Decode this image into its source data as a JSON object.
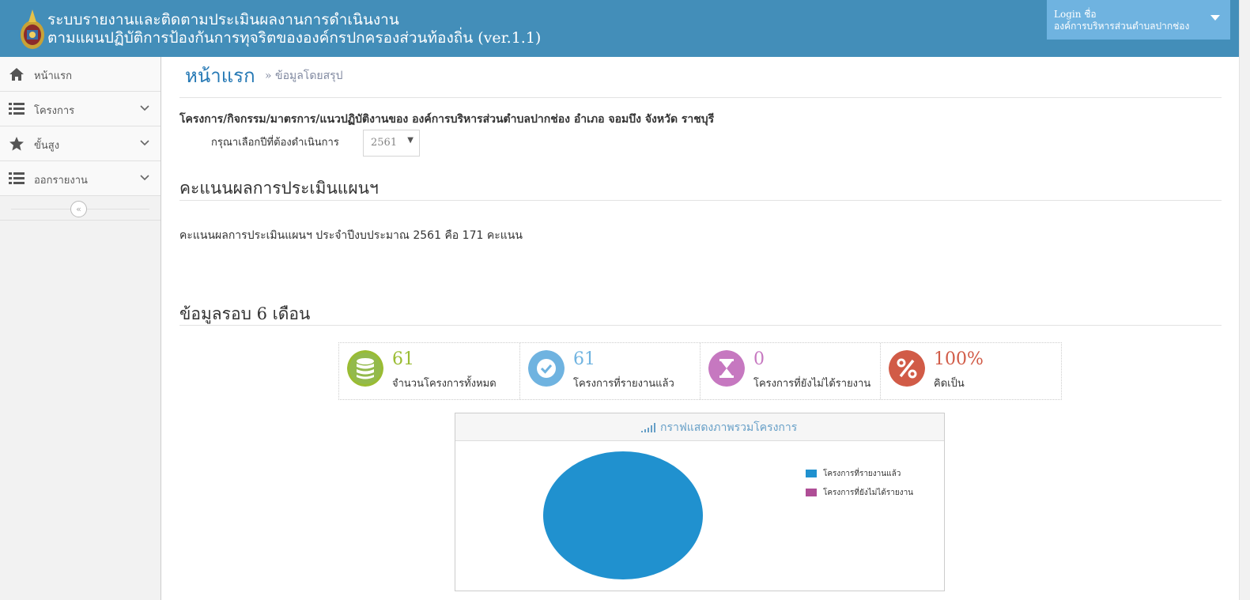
{
  "header": {
    "title_line1": "ระบบรายงานและติดตามประเมินผลงานการดำเนินงาน",
    "title_line2": "ตามแผนปฏิบัติการป้องกันการทุจริตขององค์กรปกครองส่วนท้องถิ่น (ver.1.1)",
    "user_label": "Login ชื่อ",
    "user_name": "องค์การบริหารส่วนตำบลปากช่อง"
  },
  "sidebar": {
    "items": [
      {
        "label": "หน้าแรก",
        "icon": "home-icon"
      },
      {
        "label": "โครงการ",
        "icon": "list-icon"
      },
      {
        "label": "ขั้นสูง",
        "icon": "star-icon"
      },
      {
        "label": "ออกรายงาน",
        "icon": "list-icon"
      }
    ],
    "collapse_glyph": "«"
  },
  "main": {
    "page_title": "หน้าแรก",
    "page_subtitle": "» ข้อมูลโดยสรุป",
    "project_line": "โครงการ/กิจกรรม/มาตรการ/แนวปฏิบัติงานของ องค์การบริหารส่วนตำบลปากช่อง อำเภอ จอมบึง จังหวัด ราชบุรี",
    "year_label": "กรุณาเลือกปีที่ต้องดำเนินการ",
    "year_value": "2561",
    "score_title": "คะแนนผลการประเมินแผนฯ",
    "score_text": "คะแนนผลการประเมินแผนฯ ประจำปีงบประมาณ 2561 คือ 171 คะแนน",
    "six_month_title": "ข้อมูลรอบ 6 เดือน"
  },
  "stats": [
    {
      "value": "61",
      "caption": "จำนวนโครงการทั้งหมด",
      "color": "#87b87f",
      "icon": "database-icon"
    },
    {
      "value": "61",
      "caption": "โครงการที่รายงานแล้ว",
      "color": "#6fb3e0",
      "icon": "check-circle-icon"
    },
    {
      "value": "0",
      "caption": "โครงการที่ยังไม่ได้รายงาน",
      "color": "#c678c0",
      "icon": "hourglass-icon"
    },
    {
      "value": "100%",
      "caption": "คิดเป็น",
      "color": "#d15b47",
      "icon": "percent-icon"
    }
  ],
  "chart": {
    "title": "กราฟแสดงภาพรวมโครงการ"
  },
  "chart_data": {
    "type": "pie",
    "title": "กราฟแสดงภาพรวมโครงการ",
    "categories": [
      "โครงการที่รายงานแล้ว",
      "โครงการที่ยังไม่ได้รายงาน"
    ],
    "values": [
      61,
      0
    ],
    "colors": [
      "#2091cf",
      "#af4e96"
    ],
    "legend_position": "right"
  }
}
